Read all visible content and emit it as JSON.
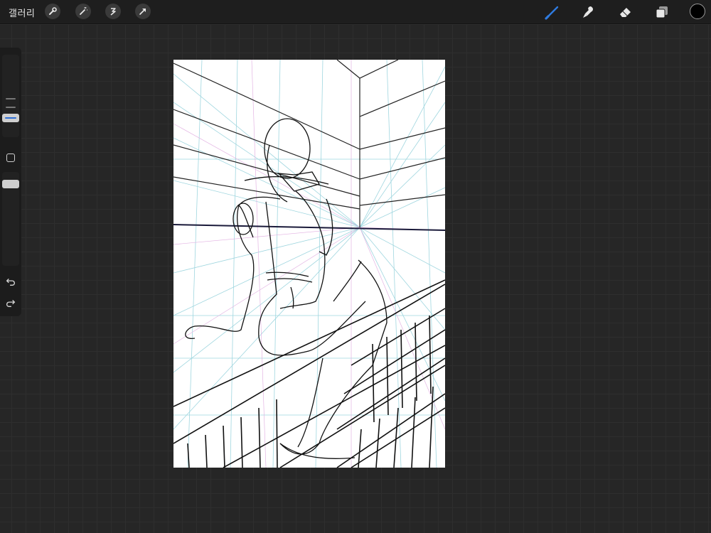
{
  "topbar": {
    "gallery_label": "갤러리",
    "actions": [
      "wrench-icon",
      "magic-wand-icon",
      "selection-icon",
      "transform-arrow-icon"
    ],
    "tools": [
      "brush-icon",
      "smudge-icon",
      "eraser-icon",
      "layers-icon"
    ],
    "active_tool": "brush-icon",
    "active_tool_color": "#2f7be0",
    "current_color": "#000000"
  },
  "sidebar": {
    "controls": [
      "brush-size-slider",
      "modify-button",
      "opacity-slider",
      "undo-icon",
      "redo-icon"
    ],
    "accent_color": "#2e6fd6"
  },
  "canvas": {
    "background": "#ffffff",
    "guide_colors": [
      "#9fd6df",
      "#e3b4e3"
    ],
    "horizon_color": "#1a1a3a"
  }
}
